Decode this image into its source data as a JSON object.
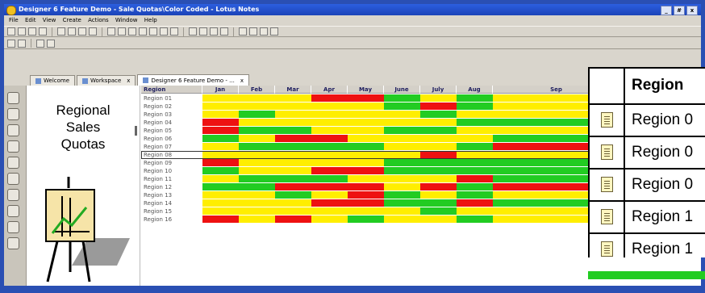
{
  "window": {
    "title": "Designer 6 Feature Demo - Sale Quotas\\Color Coded - Lotus Notes",
    "buttons": [
      "_",
      "#",
      "x"
    ]
  },
  "menu": [
    "File",
    "Edit",
    "View",
    "Create",
    "Actions",
    "Window",
    "Help"
  ],
  "tabs": [
    {
      "label": "Welcome",
      "close": ""
    },
    {
      "label": "Workspace",
      "close": "x"
    },
    {
      "label": "Designer 6 Feature Demo - ...",
      "close": "x"
    }
  ],
  "nav": {
    "title_lines": [
      "Regional",
      "Sales",
      "Quotas"
    ]
  },
  "grid": {
    "header": [
      "Region",
      "Jan",
      "Feb",
      "Mar",
      "Apr",
      "May",
      "June",
      "July",
      "Aug",
      "Sep"
    ],
    "rows": [
      {
        "label": "Region 01",
        "colors": [
          "y",
          "y",
          "y",
          "r",
          "r",
          "g",
          "y",
          "g",
          "y"
        ]
      },
      {
        "label": "Region 02",
        "colors": [
          "y",
          "y",
          "y",
          "y",
          "y",
          "g",
          "r",
          "g",
          "y"
        ]
      },
      {
        "label": "Region 03",
        "colors": [
          "y",
          "g",
          "y",
          "y",
          "y",
          "y",
          "g",
          "y",
          "y"
        ]
      },
      {
        "label": "Region 04",
        "colors": [
          "r",
          "y",
          "y",
          "y",
          "y",
          "y",
          "y",
          "g",
          "g"
        ]
      },
      {
        "label": "Region 05",
        "colors": [
          "r",
          "g",
          "g",
          "y",
          "y",
          "g",
          "g",
          "y",
          "y"
        ]
      },
      {
        "label": "Region 06",
        "colors": [
          "g",
          "y",
          "r",
          "r",
          "y",
          "y",
          "y",
          "y",
          "g"
        ]
      },
      {
        "label": "Region 07",
        "colors": [
          "y",
          "g",
          "g",
          "g",
          "g",
          "y",
          "y",
          "g",
          "r"
        ]
      },
      {
        "label": "Region 08",
        "colors": [
          "y",
          "y",
          "y",
          "y",
          "y",
          "y",
          "r",
          "y",
          "y"
        ]
      },
      {
        "label": "Region 09",
        "colors": [
          "r",
          "y",
          "y",
          "y",
          "y",
          "g",
          "g",
          "g",
          "g"
        ]
      },
      {
        "label": "Region 10",
        "colors": [
          "g",
          "y",
          "y",
          "r",
          "r",
          "g",
          "g",
          "g",
          "g"
        ]
      },
      {
        "label": "Region 11",
        "colors": [
          "y",
          "g",
          "g",
          "g",
          "y",
          "y",
          "y",
          "r",
          "g"
        ]
      },
      {
        "label": "Region 12",
        "colors": [
          "g",
          "g",
          "r",
          "r",
          "r",
          "y",
          "r",
          "g",
          "r"
        ]
      },
      {
        "label": "Region 13",
        "colors": [
          "y",
          "y",
          "g",
          "y",
          "r",
          "g",
          "y",
          "g",
          "y"
        ]
      },
      {
        "label": "Region 14",
        "colors": [
          "y",
          "y",
          "y",
          "r",
          "r",
          "g",
          "g",
          "r",
          "g"
        ]
      },
      {
        "label": "Region 15",
        "colors": [
          "y",
          "y",
          "y",
          "y",
          "y",
          "y",
          "g",
          "y",
          "y"
        ]
      },
      {
        "label": "Region 16",
        "colors": [
          "r",
          "y",
          "r",
          "y",
          "g",
          "y",
          "y",
          "g",
          "y"
        ]
      }
    ],
    "selected_row": 7
  },
  "overlay": {
    "header": "Region",
    "rows": [
      "Region 0",
      "Region 0",
      "Region 0",
      "Region 1",
      "Region 1"
    ]
  },
  "colors": {
    "red": "#ee1111",
    "yellow": "#ffee00",
    "green": "#22cc22",
    "title_blue": "#1b43b8"
  }
}
